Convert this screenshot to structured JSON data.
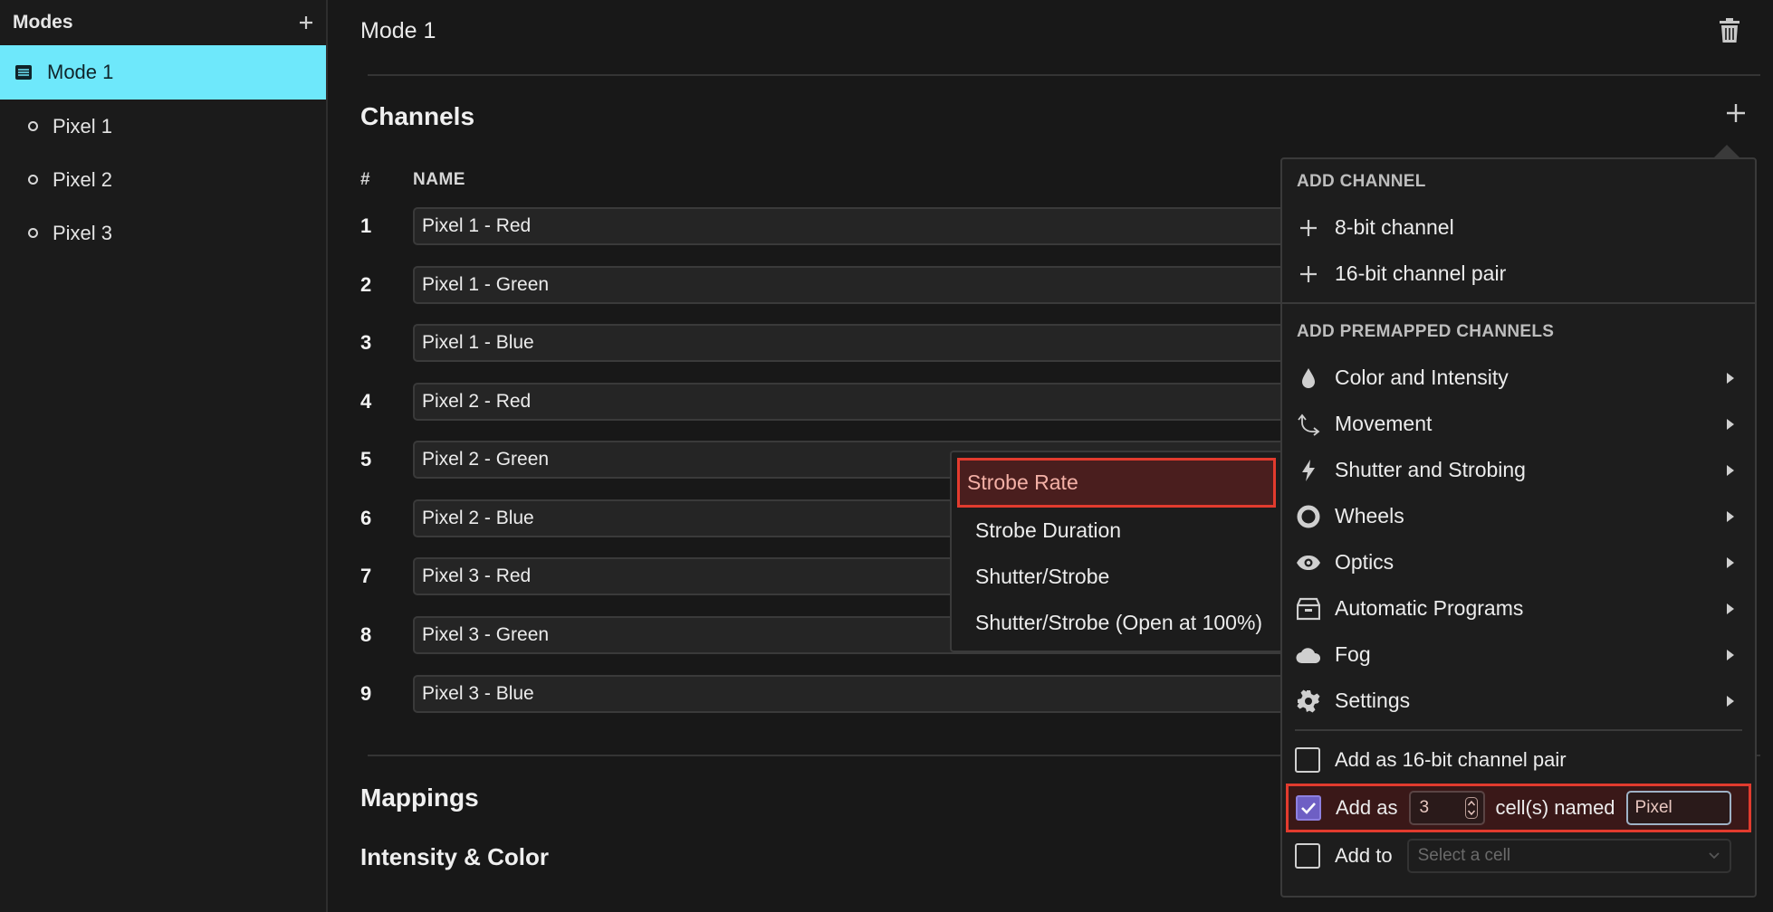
{
  "sidebar": {
    "title": "Modes",
    "modes": [
      {
        "label": "Mode 1",
        "icon": "list-icon"
      }
    ],
    "pixels": [
      {
        "label": "Pixel 1"
      },
      {
        "label": "Pixel 2"
      },
      {
        "label": "Pixel 3"
      }
    ]
  },
  "main": {
    "mode_title": "Mode 1",
    "channels_heading": "Channels",
    "col_number": "#",
    "col_name": "NAME",
    "channels": [
      {
        "num": "1",
        "name": "Pixel 1 - Red"
      },
      {
        "num": "2",
        "name": "Pixel 1 - Green"
      },
      {
        "num": "3",
        "name": "Pixel 1 - Blue"
      },
      {
        "num": "4",
        "name": "Pixel 2 - Red"
      },
      {
        "num": "5",
        "name": "Pixel 2 - Green"
      },
      {
        "num": "6",
        "name": "Pixel 2 - Blue"
      },
      {
        "num": "7",
        "name": "Pixel 3 - Red"
      },
      {
        "num": "8",
        "name": "Pixel 3 - Green"
      },
      {
        "num": "9",
        "name": "Pixel 3 - Blue"
      }
    ],
    "mappings_heading": "Mappings",
    "intensity_heading": "Intensity & Color"
  },
  "submenu": {
    "items": [
      "Strobe Rate",
      "Strobe Duration",
      "Shutter/Strobe",
      "Shutter/Strobe (Open at 100%)"
    ]
  },
  "panel": {
    "add_channel_header": "ADD CHANNEL",
    "add_8bit": "8-bit channel",
    "add_16bit": "16-bit channel pair",
    "premapped_header": "ADD PREMAPPED CHANNELS",
    "categories": [
      {
        "label": "Color and Intensity",
        "icon": "droplet-icon"
      },
      {
        "label": "Movement",
        "icon": "movement-icon"
      },
      {
        "label": "Shutter and Strobing",
        "icon": "bolt-icon"
      },
      {
        "label": "Wheels",
        "icon": "wheel-icon"
      },
      {
        "label": "Optics",
        "icon": "eye-icon"
      },
      {
        "label": "Automatic Programs",
        "icon": "archive-icon"
      },
      {
        "label": "Fog",
        "icon": "cloud-icon"
      },
      {
        "label": "Settings",
        "icon": "gear-icon"
      }
    ],
    "opt_16bit_label": "Add as 16-bit channel pair",
    "opt_16bit_checked": false,
    "opt_cells_prefix": "Add as",
    "opt_cells_count": "3",
    "opt_cells_middle": "cell(s) named",
    "opt_cells_name": "Pixel",
    "opt_cells_checked": true,
    "opt_addto_label": "Add to",
    "opt_addto_placeholder": "Select a cell",
    "opt_addto_checked": false
  },
  "colors": {
    "accent": "#6ee8fb",
    "highlight_border": "#e23b2e",
    "checkbox_checked": "#6e5fc4"
  }
}
